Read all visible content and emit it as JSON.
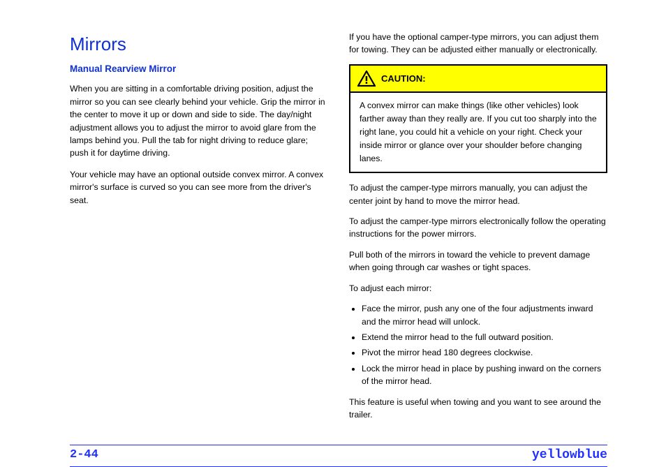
{
  "left": {
    "heading": "Mirrors",
    "subheading": "Manual Rearview Mirror",
    "para1": "When you are sitting in a comfortable driving position, adjust the mirror so you can see clearly behind your vehicle. Grip the mirror in the center to move it up or down and side to side. The day/night adjustment allows you to adjust the mirror to avoid glare from the lamps behind you. Pull the tab for night driving to reduce glare; push it for daytime driving.",
    "para2": "Your vehicle may have an optional outside convex mirror. A convex mirror's surface is curved so you can see more from the driver's seat."
  },
  "caution": {
    "title": "CAUTION:",
    "body": "A convex mirror can make things (like other vehicles) look farther away than they really are. If you cut too sharply into the right lane, you could hit a vehicle on your right. Check your inside mirror or glance over your shoulder before changing lanes."
  },
  "right": {
    "paraTop": "If you have the optional camper-type mirrors, you can adjust them for towing. They can be adjusted either manually or electronically.",
    "paraA": "To adjust the camper-type mirrors manually, you can adjust the center joint by hand to move the mirror head.",
    "paraB": "To adjust the camper-type mirrors electronically follow the operating instructions for the power mirrors.",
    "paraAfter": "Pull both of the mirrors in toward the vehicle to prevent damage when going through car washes or tight spaces.",
    "adjustTitle": "To adjust each mirror:",
    "bullets": [
      "Face the mirror, push any one of the four adjustments inward and the mirror head will unlock.",
      "Extend the mirror head to the full outward position.",
      "Pivot the mirror head 180 degrees clockwise.",
      "Lock the mirror head in place by pushing inward on the corners of the mirror head."
    ],
    "paraFinal": "This feature is useful when towing and you want to see around the trailer."
  },
  "footer": {
    "link": "yellowblue",
    "page": "2-44"
  }
}
